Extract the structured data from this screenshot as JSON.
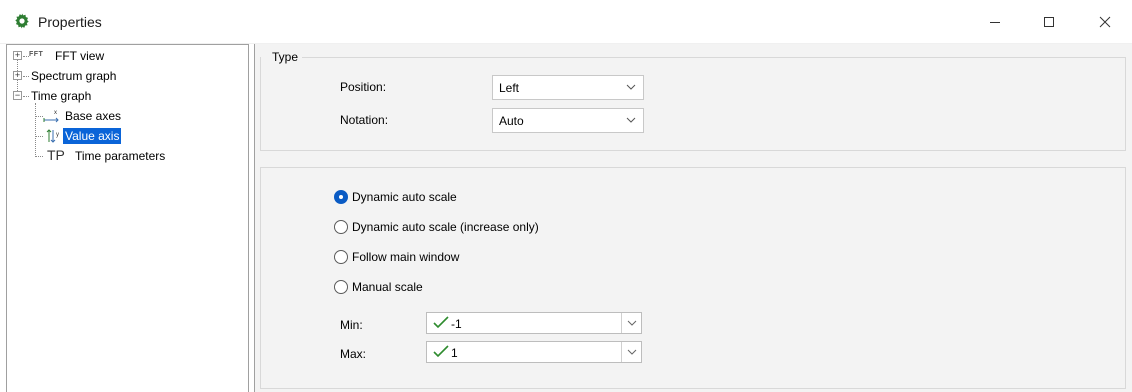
{
  "window": {
    "title": "Properties",
    "icon": "gear-icon",
    "minimize": "minimize-icon",
    "maximize": "maximize-icon",
    "close": "close-icon"
  },
  "tree": {
    "items": [
      {
        "label": "FFT view",
        "icon_text": "FFT",
        "expander": "+"
      },
      {
        "label": "Spectrum graph",
        "expander": "+"
      },
      {
        "label": "Time graph",
        "expander": "−"
      },
      {
        "label": "Base axes",
        "icon": "base-axes-icon"
      },
      {
        "label": "Value axis",
        "icon": "value-axis-icon",
        "selected": true
      },
      {
        "label": "Time parameters",
        "icon_text": "TP"
      }
    ]
  },
  "type_group": {
    "legend": "Type",
    "position": {
      "label": "Position:",
      "value": "Left"
    },
    "notation": {
      "label": "Notation:",
      "value": "Auto"
    }
  },
  "scale_group": {
    "options": [
      {
        "label": "Dynamic auto scale",
        "checked": true
      },
      {
        "label": "Dynamic auto scale (increase only)",
        "checked": false
      },
      {
        "label": "Follow main window",
        "checked": false
      },
      {
        "label": "Manual scale",
        "checked": false
      }
    ],
    "min": {
      "label": "Min:",
      "value": "-1"
    },
    "max": {
      "label": "Max:",
      "value": "1"
    }
  },
  "colors": {
    "selection": "#0a64d8",
    "radio_checked": "#0a5bc4",
    "check": "#2e8b2e",
    "panel_bg": "#f3f3f3"
  }
}
